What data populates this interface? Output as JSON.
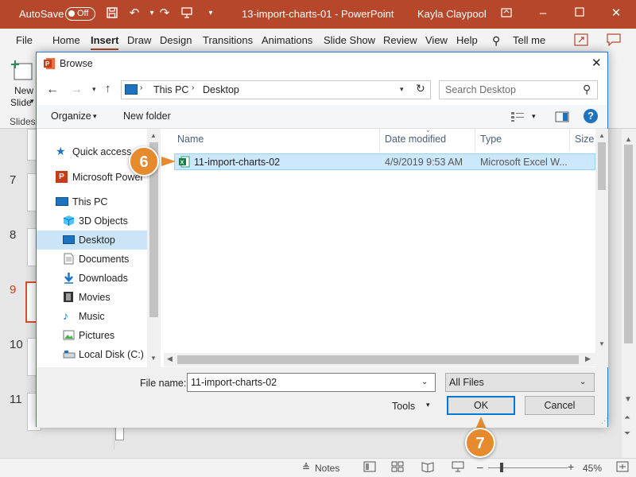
{
  "titlebar": {
    "autosave_label": "AutoSave",
    "autosave_state": "Off",
    "document_title": "13-import-charts-01 - PowerPoint",
    "user_name": "Kayla Claypool"
  },
  "ribbon_tabs": [
    "File",
    "Home",
    "Insert",
    "Draw",
    "Design",
    "Transitions",
    "Animations",
    "Slide Show",
    "Review",
    "View",
    "Help"
  ],
  "tell_me": "Tell me",
  "ribbon": {
    "new_slide_label_1": "New",
    "new_slide_label_2": "Slide",
    "group_label": "Slides"
  },
  "slides": {
    "numbers": [
      "7",
      "8",
      "9",
      "10",
      "11"
    ],
    "selected": "9"
  },
  "statusbar": {
    "notes_label": "Notes",
    "zoom_level": "45%"
  },
  "dialog": {
    "title": "Browse",
    "address": {
      "segment_1": "This PC",
      "segment_2": "Desktop"
    },
    "search_placeholder": "Search Desktop",
    "toolbar": {
      "organize_label": "Organize",
      "new_folder_label": "New folder"
    },
    "nav_items": [
      {
        "label": "Quick access"
      },
      {
        "label": "Microsoft Power"
      },
      {
        "label": "This PC"
      },
      {
        "label": "3D Objects"
      },
      {
        "label": "Desktop"
      },
      {
        "label": "Documents"
      },
      {
        "label": "Downloads"
      },
      {
        "label": "Movies"
      },
      {
        "label": "Music"
      },
      {
        "label": "Pictures"
      },
      {
        "label": "Local Disk (C:)"
      }
    ],
    "columns": [
      "Name",
      "Date modified",
      "Type",
      "Size"
    ],
    "files": [
      {
        "name": "11-import-charts-02",
        "date_modified": "4/9/2019 9:53 AM",
        "type": "Microsoft Excel W..."
      }
    ],
    "file_name_label": "File name:",
    "file_name_value": "11-import-charts-02",
    "file_type_value": "All Files",
    "tools_label": "Tools",
    "ok_label": "OK",
    "cancel_label": "Cancel"
  },
  "callouts": {
    "step_6": "6",
    "step_7": "7"
  },
  "colors": {
    "accent": "#b7472a",
    "selection": "#cce8ff",
    "callout": "#e68a2e",
    "dialog_border": "#2b79d0"
  }
}
